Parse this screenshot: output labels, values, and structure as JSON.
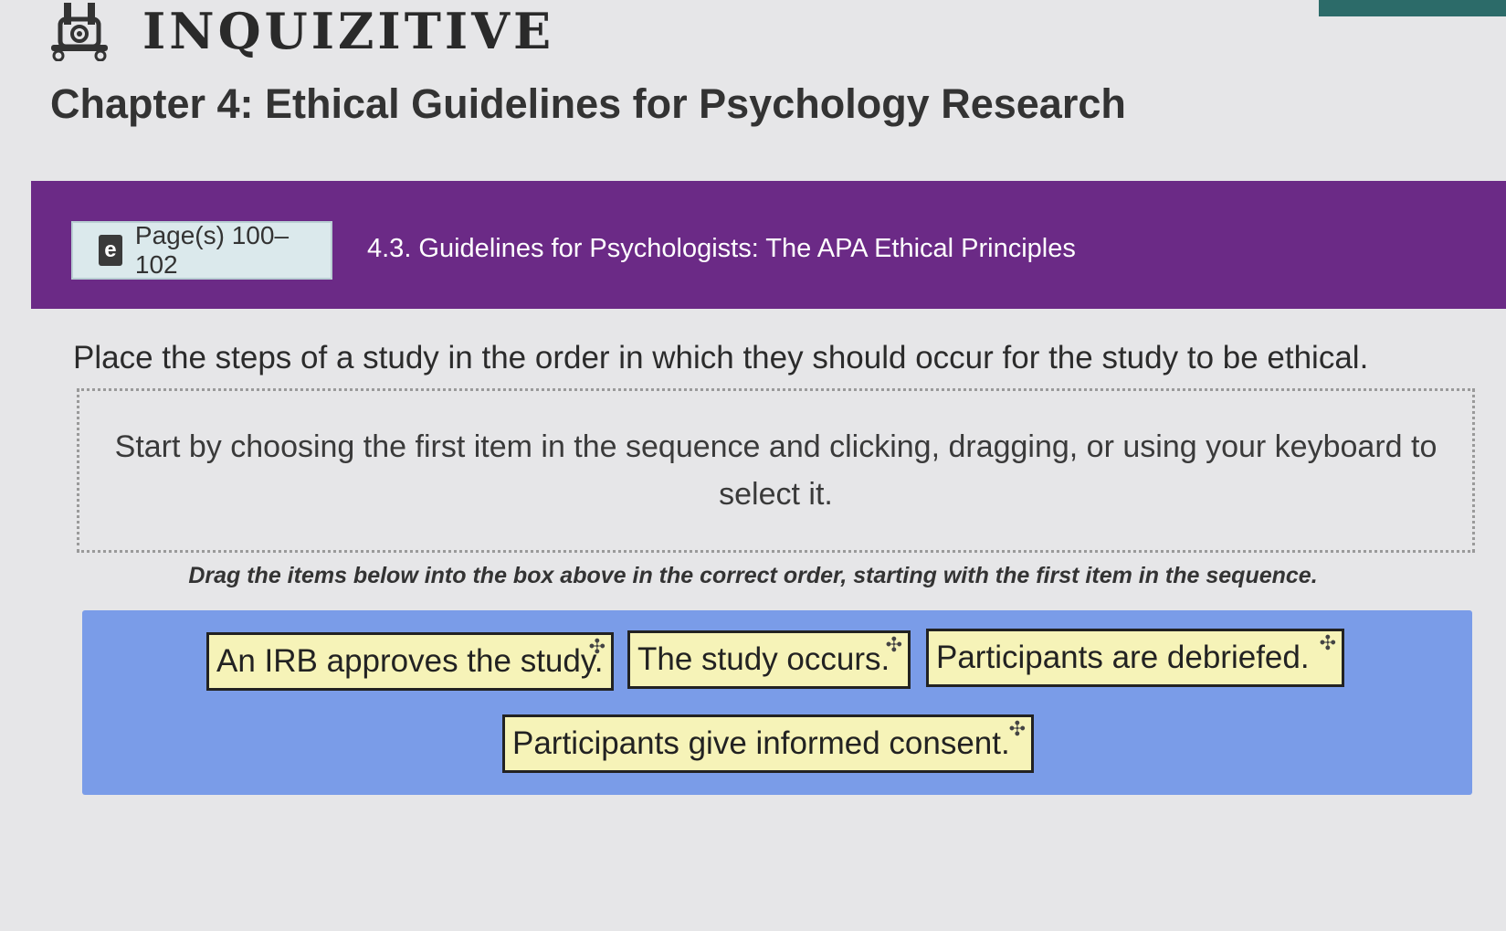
{
  "brand": {
    "name": "INQUIZITIVE",
    "logo_icon": "inquizitive-logo-icon"
  },
  "chapter": {
    "title": "Chapter 4: Ethical Guidelines for Psychology Research"
  },
  "banner": {
    "page_ref_label": "Page(s) 100–102",
    "page_ref_icon": "ebook-icon",
    "section_title": "4.3. Guidelines for Psychologists: The APA Ethical Principles",
    "color": "#6b2a86"
  },
  "question": {
    "prompt": "Place the steps of a study in the order in which they should occur for the study to be ethical.",
    "dropzone_hint": "Start by choosing the first item in the sequence and clicking, dragging, or using your keyboard to select it.",
    "drag_instruction": "Drag the items below into the box above in the correct order, starting with the first item in the sequence."
  },
  "items": [
    {
      "label": "An IRB approves the study."
    },
    {
      "label": "The study occurs."
    },
    {
      "label": "Participants are debriefed."
    },
    {
      "label": "Participants give informed consent."
    }
  ],
  "colors": {
    "pool_bg": "#7a9ce8",
    "item_bg": "#f6f3b8",
    "accent": "#2c6b69"
  }
}
